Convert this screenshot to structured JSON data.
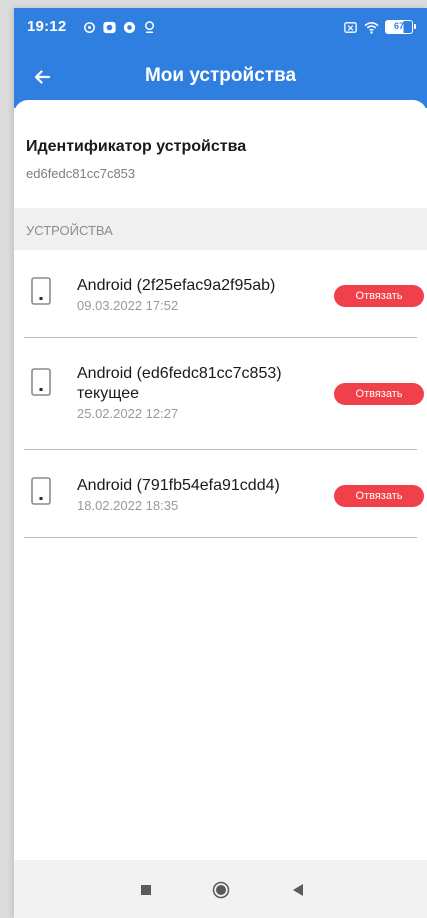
{
  "status_bar": {
    "time": "19:12",
    "battery": "67"
  },
  "app_bar": {
    "title": "Мои устройства"
  },
  "identifier": {
    "title": "Идентификатор устройства",
    "value": "ed6fedc81cc7c853"
  },
  "devices_section": {
    "header": "УСТРОЙСТВА",
    "items": [
      {
        "name": "Android (2f25efac9a2f95ab)",
        "current": "",
        "date": "09.03.2022 17:52",
        "button": "Отвязать"
      },
      {
        "name": "Android (ed6fedc81cc7c853)",
        "current": "текущее",
        "date": "25.02.2022 12:27",
        "button": "Отвязать"
      },
      {
        "name": "Android (791fb54efa91cdd4)",
        "current": "",
        "date": "18.02.2022 18:35",
        "button": "Отвязать"
      }
    ]
  },
  "colors": {
    "primary": "#2f7fe0",
    "danger": "#f0404a"
  },
  "icons": {
    "back": "arrow-left-icon",
    "device": "phone-icon",
    "nav_recents": "square-icon",
    "nav_home": "circle-icon",
    "nav_back": "triangle-left-icon"
  }
}
